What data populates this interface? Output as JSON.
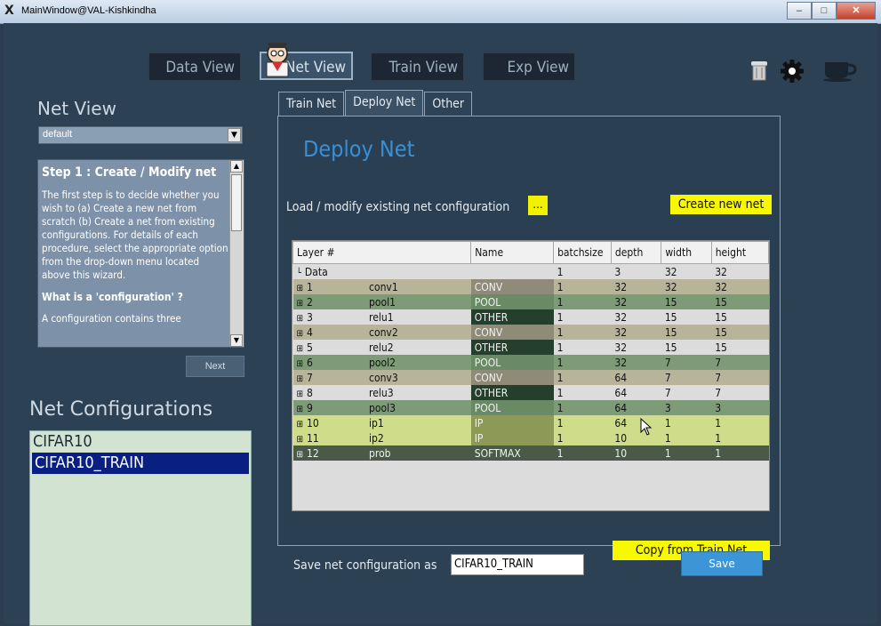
{
  "window": {
    "title": "MainWindow@VAL-Kishkindha",
    "buttons": [
      "–",
      "□",
      "✕"
    ]
  },
  "top_nav": [
    {
      "label": "Data View",
      "active": false
    },
    {
      "label": "Net View",
      "active": true
    },
    {
      "label": "Train View",
      "active": false
    },
    {
      "label": "Exp View",
      "active": false
    }
  ],
  "top_right_icons": [
    "trash-icon",
    "gear-icon",
    "coffee-cup-icon"
  ],
  "sidebar": {
    "title": "Net View",
    "dropdown_value": "default",
    "wizard": {
      "step_title": "Step 1 : Create / Modify net",
      "body": "The first step is to decide whether you wish to (a) Create a new net from scratch (b) Create a net from existing configurations. For details of each procedure, select the appropriate option from the drop-down menu located above this wizard.",
      "question": "What is a 'configuration' ?",
      "tail": "A configuration contains three"
    },
    "next_label": "Next",
    "configs_title": "Net Configurations",
    "configs": [
      "CIFAR10",
      "CIFAR10_TRAIN"
    ],
    "selected_config": "CIFAR10_TRAIN"
  },
  "tabs": [
    {
      "label": "Train Net",
      "active": false
    },
    {
      "label": "Deploy Net",
      "active": true
    },
    {
      "label": "Other",
      "active": false
    }
  ],
  "panel": {
    "title": "Deploy Net",
    "load_label": "Load / modify existing net configuration",
    "browse_label": "...",
    "create_label": "Create new net",
    "copy_label": "Copy from Train Net"
  },
  "grid": {
    "columns": [
      "Layer #",
      "Name",
      "batchsize",
      "depth",
      "width",
      "height"
    ],
    "rows": [
      {
        "layer": "Data",
        "name": "",
        "type": "",
        "batch": "1",
        "depth": "3",
        "width": "32",
        "height": "32",
        "bg": "#dcdcdc",
        "typebg": "#dcdcdc",
        "expand": false
      },
      {
        "layer": "1",
        "name": "conv1",
        "type": "CONV",
        "batch": "1",
        "depth": "32",
        "width": "32",
        "height": "32",
        "bg": "#b8b49a",
        "typebg": "#8f8b78",
        "expand": true
      },
      {
        "layer": "2",
        "name": "pool1",
        "type": "POOL",
        "batch": "1",
        "depth": "32",
        "width": "15",
        "height": "15",
        "bg": "#7c9b76",
        "typebg": "#6a8a65",
        "expand": true
      },
      {
        "layer": "3",
        "name": "relu1",
        "type": "OTHER",
        "batch": "1",
        "depth": "32",
        "width": "15",
        "height": "15",
        "bg": "#dcdcdc",
        "typebg": "#24402c",
        "expand": true
      },
      {
        "layer": "4",
        "name": "conv2",
        "type": "CONV",
        "batch": "1",
        "depth": "32",
        "width": "15",
        "height": "15",
        "bg": "#b8b49a",
        "typebg": "#8f8b78",
        "expand": true
      },
      {
        "layer": "5",
        "name": "relu2",
        "type": "OTHER",
        "batch": "1",
        "depth": "32",
        "width": "15",
        "height": "15",
        "bg": "#dcdcdc",
        "typebg": "#24402c",
        "expand": true
      },
      {
        "layer": "6",
        "name": "pool2",
        "type": "POOL",
        "batch": "1",
        "depth": "32",
        "width": "7",
        "height": "7",
        "bg": "#7c9b76",
        "typebg": "#6a8a65",
        "expand": true
      },
      {
        "layer": "7",
        "name": "conv3",
        "type": "CONV",
        "batch": "1",
        "depth": "64",
        "width": "7",
        "height": "7",
        "bg": "#b8b49a",
        "typebg": "#8f8b78",
        "expand": true
      },
      {
        "layer": "8",
        "name": "relu3",
        "type": "OTHER",
        "batch": "1",
        "depth": "64",
        "width": "7",
        "height": "7",
        "bg": "#dcdcdc",
        "typebg": "#24402c",
        "expand": true
      },
      {
        "layer": "9",
        "name": "pool3",
        "type": "POOL",
        "batch": "1",
        "depth": "64",
        "width": "3",
        "height": "3",
        "bg": "#7c9b76",
        "typebg": "#6a8a65",
        "expand": true
      },
      {
        "layer": "10",
        "name": "ip1",
        "type": "IP",
        "batch": "1",
        "depth": "64",
        "width": "1",
        "height": "1",
        "bg": "#cfdc8a",
        "typebg": "#8d9a55",
        "expand": true
      },
      {
        "layer": "11",
        "name": "ip2",
        "type": "IP",
        "batch": "1",
        "depth": "10",
        "width": "1",
        "height": "1",
        "bg": "#cfdc8a",
        "typebg": "#8d9a55",
        "expand": true
      },
      {
        "layer": "12",
        "name": "prob",
        "type": "SOFTMAX",
        "batch": "1",
        "depth": "10",
        "width": "1",
        "height": "1",
        "bg": "#4a5a48",
        "typebg": "#4a5a48",
        "expand": true
      }
    ]
  },
  "save": {
    "label": "Save net configuration as",
    "value": "CIFAR10_TRAIN",
    "button": "Save"
  }
}
